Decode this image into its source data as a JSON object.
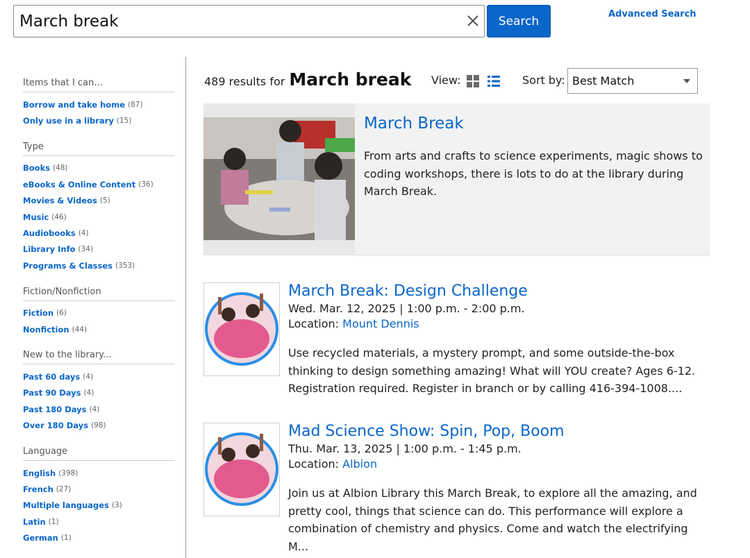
{
  "search": {
    "query": "March break",
    "placeholder": "",
    "search_label": "Search",
    "advanced_label": "Advanced Search"
  },
  "facets": [
    {
      "title": "Items that I can...",
      "items": [
        {
          "label": "Borrow and take home",
          "count": "(87)"
        },
        {
          "label": "Only use in a library",
          "count": "(15)"
        }
      ]
    },
    {
      "title": "Type",
      "items": [
        {
          "label": "Books",
          "count": "(48)"
        },
        {
          "label": "eBooks & Online Content",
          "count": "(36)"
        },
        {
          "label": "Movies & Videos",
          "count": "(5)"
        },
        {
          "label": "Music",
          "count": "(46)"
        },
        {
          "label": "Audiobooks",
          "count": "(4)"
        },
        {
          "label": "Library Info",
          "count": "(34)"
        },
        {
          "label": "Programs & Classes",
          "count": "(353)"
        }
      ]
    },
    {
      "title": "Fiction/Nonfiction",
      "items": [
        {
          "label": "Fiction",
          "count": "(6)"
        },
        {
          "label": "Nonfiction",
          "count": "(44)"
        }
      ]
    },
    {
      "title": "New to the library...",
      "items": [
        {
          "label": "Past 60 days",
          "count": "(4)"
        },
        {
          "label": "Past 90 Days",
          "count": "(4)"
        },
        {
          "label": "Past 180 Days",
          "count": "(4)"
        },
        {
          "label": "Over 180 Days",
          "count": "(98)"
        }
      ]
    },
    {
      "title": "Language",
      "items": [
        {
          "label": "English",
          "count": "(398)"
        },
        {
          "label": "French",
          "count": "(27)"
        },
        {
          "label": "Multiple languages",
          "count": "(3)"
        },
        {
          "label": "Latin",
          "count": "(1)"
        },
        {
          "label": "German",
          "count": "(1)"
        }
      ]
    }
  ],
  "results": {
    "count_text": "489 results for",
    "query_text": "March break",
    "view_label": "View:",
    "sort_label": "Sort by:",
    "sort_value": "Best Match"
  },
  "featured": {
    "title": "March Break",
    "description": "From arts and crafts to science experiments, magic shows to coding workshops, there is lots to do at the library during March Break."
  },
  "events": [
    {
      "title": "March Break: Design Challenge",
      "date": "Wed. Mar. 12, 2025 | 1:00 p.m. - 2:00 p.m.",
      "location_label": "Location: ",
      "location": "Mount Dennis",
      "description": "Use recycled materials, a mystery prompt, and some outside-the-box thinking to design something amazing! What will YOU create? Ages 6-12. Registration required. Register in branch or by calling 416-394-1008...."
    },
    {
      "title": "Mad Science Show: Spin, Pop, Boom",
      "date": "Thu. Mar. 13, 2025 | 1:00 p.m. - 1:45 p.m.",
      "location_label": "Location: ",
      "location": "Albion",
      "description": "Join us at Albion Library this March Break, to explore all the amazing, and pretty cool, things that science can do. This performance will explore a combination of chemistry and physics. Come and watch the electrifying M..."
    }
  ],
  "colors": {
    "link": "#0a66c8",
    "button": "#0a66c8",
    "featured_bg": "#f2f2f2",
    "thumb_ring": "#2a8fe6"
  },
  "icons": {
    "clear": "close-icon",
    "grid_view": "grid-view-icon",
    "list_view": "list-view-icon",
    "dropdown": "caret-down-icon"
  }
}
